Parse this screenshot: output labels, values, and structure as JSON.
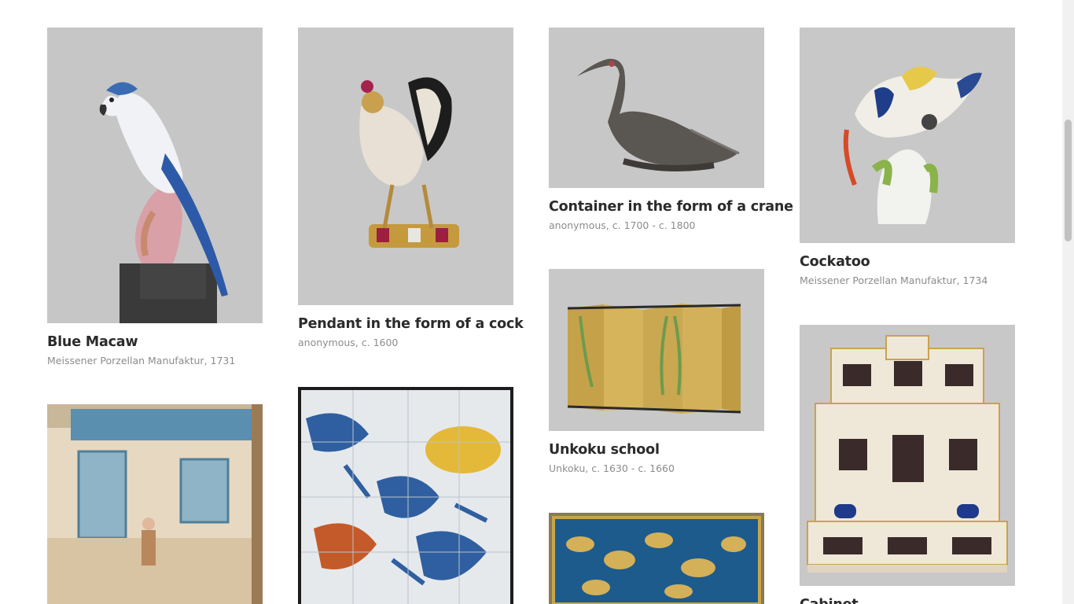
{
  "artworks": [
    {
      "title": "Blue Macaw",
      "meta": "Meissener Porzellan Manufaktur, 1731"
    },
    {
      "title": "Pendant in the form of a cock",
      "meta": "anonymous, c. 1600"
    },
    {
      "title": "Container in the form of a crane",
      "meta": "anonymous, c. 1700 - c. 1800"
    },
    {
      "title": "Cockatoo",
      "meta": "Meissener Porzellan Manufaktur, 1734"
    },
    {
      "title": "Unkoku school",
      "meta": "Unkoku, c. 1630 - c. 1660"
    },
    {
      "title": "Cabinet",
      "meta": ""
    }
  ],
  "colors": {
    "title_text": "#2b2b2b",
    "meta_text": "#8c8c8c",
    "image_background": "#c9c9c9",
    "scrollbar_track": "#f1f1f1",
    "scrollbar_thumb": "#c1c1c1"
  },
  "scroll_position": 0.2
}
